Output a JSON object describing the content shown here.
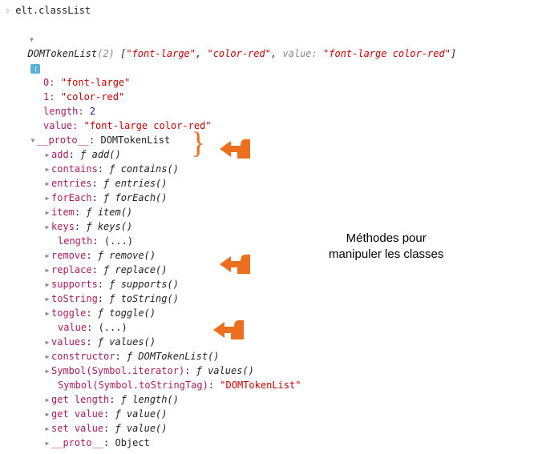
{
  "input": {
    "text": "elt.classList"
  },
  "result": {
    "type": "DOMTokenList",
    "count": "(2)",
    "array_open": "[",
    "v0": "\"font-large\"",
    "sep": ", ",
    "v1": "\"color-red\"",
    "value_key": "value:",
    "value_val": "\"font-large color-red\"",
    "array_close": "]"
  },
  "info_badge": "i",
  "props": {
    "idx0_key": "0:",
    "idx0_val": "\"font-large\"",
    "idx1_key": "1:",
    "idx1_val": "\"color-red\"",
    "length_key": "length:",
    "length_val": "2",
    "value_key": "value:",
    "value_val": "\"font-large color-red\"",
    "proto_key": "__proto__",
    "proto_val": "DOMTokenList"
  },
  "methods": [
    {
      "name": "add",
      "sig": "add()"
    },
    {
      "name": "contains",
      "sig": "contains()"
    },
    {
      "name": "entries",
      "sig": "entries()"
    },
    {
      "name": "forEach",
      "sig": "forEach()"
    },
    {
      "name": "item",
      "sig": "item()"
    },
    {
      "name": "keys",
      "sig": "keys()"
    }
  ],
  "length_ellipsis": {
    "key": "length",
    "val": "(...)"
  },
  "methods2": [
    {
      "name": "remove",
      "sig": "remove()"
    },
    {
      "name": "replace",
      "sig": "replace()"
    },
    {
      "name": "supports",
      "sig": "supports()"
    },
    {
      "name": "toString",
      "sig": "toString()"
    },
    {
      "name": "toggle",
      "sig": "toggle()"
    }
  ],
  "value_ellipsis": {
    "key": "value",
    "val": "(...)"
  },
  "methods3": [
    {
      "name": "values",
      "sig": "values()"
    },
    {
      "name": "constructor",
      "sig": "DOMTokenList()"
    }
  ],
  "symbol_iter": {
    "key": "Symbol(Symbol.iterator)",
    "sig": "values()"
  },
  "symbol_tag": {
    "key": "Symbol(Symbol.toStringTag)",
    "val": "\"DOMTokenList\""
  },
  "getters": [
    {
      "name": "get length",
      "sig": "length()"
    },
    {
      "name": "get value",
      "sig": "value()"
    },
    {
      "name": "set value",
      "sig": "value()"
    }
  ],
  "proto2": {
    "key": "__proto__",
    "val": "Object"
  },
  "annotation": {
    "line1": "Méthodes pour",
    "line2": "manipuler les classes"
  },
  "glyphs": {
    "right": "▸",
    "down": "▾",
    "colon": ": ",
    "f": "ƒ "
  }
}
